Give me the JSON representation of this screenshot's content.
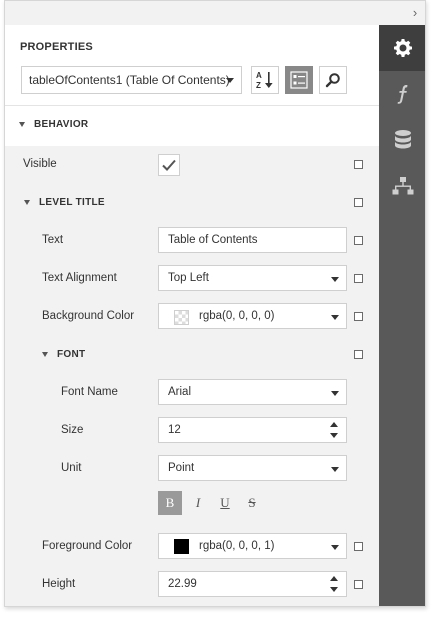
{
  "panel": {
    "title": "PROPERTIES",
    "object_selector": "tableOfContents1 (Table Of Contents)"
  },
  "toolbar": {
    "sort_icon": "sort-alpha-icon",
    "categories_icon": "categories-icon",
    "search_icon": "search-icon"
  },
  "sidebar": {
    "items": [
      {
        "name": "properties",
        "icon": "gear-icon",
        "active": true
      },
      {
        "name": "expressions",
        "icon": "function-icon",
        "active": false
      },
      {
        "name": "data-source",
        "icon": "database-icon",
        "active": false
      },
      {
        "name": "report-explorer",
        "icon": "hierarchy-icon",
        "active": false
      }
    ]
  },
  "behavior": {
    "header": "BEHAVIOR",
    "visible_label": "Visible",
    "visible_checked": true
  },
  "level_title": {
    "header": "LEVEL TITLE",
    "text_label": "Text",
    "text_value": "Table of Contents",
    "alignment_label": "Text Alignment",
    "alignment_value": "Top Left",
    "bg_color_label": "Background Color",
    "bg_color_value": "rgba(0, 0, 0, 0)",
    "font": {
      "header": "FONT",
      "name_label": "Font Name",
      "name_value": "Arial",
      "size_label": "Size",
      "size_value": "12",
      "unit_label": "Unit",
      "unit_value": "Point",
      "format_buttons": [
        "B",
        "I",
        "U",
        "S"
      ]
    },
    "fg_color_label": "Foreground Color",
    "fg_color_value": "rgba(0, 0, 0, 1)",
    "height_label": "Height",
    "height_value": "22.99"
  },
  "colors": {
    "sidebar_bg": "#595959",
    "sidebar_active": "#3e3e3e",
    "grid_bg": "#f2f2f2",
    "toggle_on": "#888888"
  }
}
